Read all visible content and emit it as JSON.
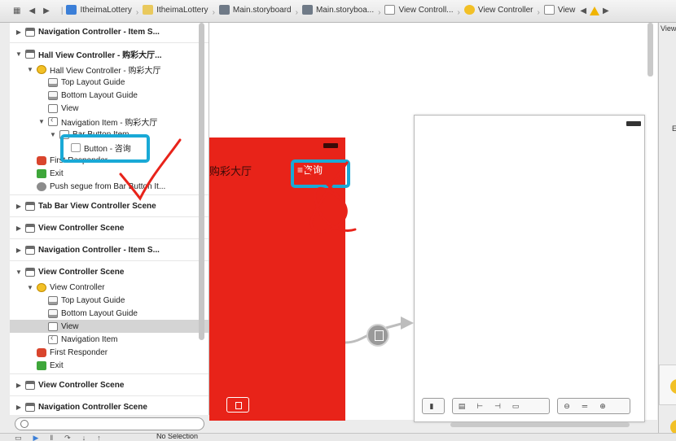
{
  "jumpbar": {
    "crumbs": [
      {
        "label": "ItheimaLottery",
        "icon": "project-icon"
      },
      {
        "label": "ItheimaLottery",
        "icon": "folder-icon"
      },
      {
        "label": "Main.storyboard",
        "icon": "storyboard-file-icon"
      },
      {
        "label": "Main.storyboa...",
        "icon": "storyboard-file-icon"
      },
      {
        "label": "View Controll...",
        "icon": "scene-icon"
      },
      {
        "label": "View Controller",
        "icon": "view-controller-icon"
      },
      {
        "label": "View",
        "icon": "view-icon"
      }
    ]
  },
  "outline": {
    "rows": [
      {
        "label": "Navigation Controller - Item S...",
        "type": "scene",
        "depth": 0,
        "expanded": false
      },
      {
        "label": "Hall View Controller - 购彩大厅...",
        "type": "scene",
        "depth": 0,
        "expanded": true
      },
      {
        "label": "Hall View Controller - 购彩大厅",
        "type": "vc",
        "depth": 1,
        "expanded": true
      },
      {
        "label": "Top Layout Guide",
        "type": "guide",
        "depth": 2
      },
      {
        "label": "Bottom Layout Guide",
        "type": "guide",
        "depth": 2
      },
      {
        "label": "View",
        "type": "view",
        "depth": 2
      },
      {
        "label": "Navigation Item - 购彩大厅",
        "type": "nav",
        "depth": 2,
        "expanded": true
      },
      {
        "label": "Bar Button Item",
        "type": "bar",
        "depth": 3,
        "expanded": true
      },
      {
        "label": "Button - 咨询",
        "type": "button",
        "depth": 4
      },
      {
        "label": "First Responder",
        "type": "responder",
        "depth": 1
      },
      {
        "label": "Exit",
        "type": "exit",
        "depth": 1
      },
      {
        "label": "Push segue from Bar Button It...",
        "type": "segue",
        "depth": 1
      },
      {
        "label": "Tab Bar View Controller Scene",
        "type": "scene",
        "depth": 0,
        "expanded": false
      },
      {
        "label": "View Controller Scene",
        "type": "scene",
        "depth": 0,
        "expanded": false
      },
      {
        "label": "Navigation Controller - Item S...",
        "type": "scene",
        "depth": 0,
        "expanded": false
      },
      {
        "label": "View Controller Scene",
        "type": "scene",
        "depth": 0,
        "expanded": true
      },
      {
        "label": "View Controller",
        "type": "vc",
        "depth": 1,
        "expanded": true
      },
      {
        "label": "Top Layout Guide",
        "type": "guide",
        "depth": 2
      },
      {
        "label": "Bottom Layout Guide",
        "type": "guide",
        "depth": 2
      },
      {
        "label": "View",
        "type": "view",
        "depth": 2,
        "selected": true
      },
      {
        "label": "Navigation Item",
        "type": "nav",
        "depth": 2
      },
      {
        "label": "First Responder",
        "type": "responder",
        "depth": 1
      },
      {
        "label": "Exit",
        "type": "exit",
        "depth": 1
      },
      {
        "label": "View Controller Scene",
        "type": "scene",
        "depth": 0,
        "expanded": false
      },
      {
        "label": "Navigation Controller Scene",
        "type": "scene",
        "depth": 0,
        "expanded": false
      }
    ]
  },
  "canvas": {
    "red_scene": {
      "title": "购彩大厅",
      "button": "≡咨询",
      "color": "#e82319"
    },
    "white_scene": {}
  },
  "inspector": {
    "title": "View",
    "label": "E"
  },
  "status": {
    "selection": "No Selection"
  },
  "annotations": {
    "highlight_color": "#19a9d6",
    "pen_color": "#e8231a"
  }
}
